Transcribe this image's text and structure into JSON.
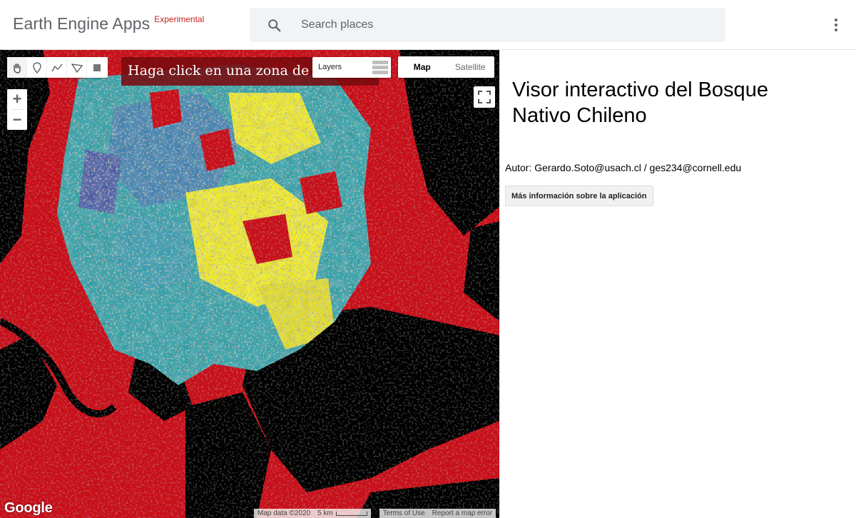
{
  "header": {
    "app_name": "Earth Engine Apps",
    "app_tag": "Experimental",
    "search_placeholder": "Search places",
    "search_icon": "search-icon",
    "menu_icon": "more-vertical-icon"
  },
  "map": {
    "draw_tools": [
      "hand-icon",
      "marker-icon",
      "line-icon",
      "polygon-icon",
      "rectangle-icon"
    ],
    "instruction": "Haga click en una zona de",
    "layers_label": "Layers",
    "map_types": {
      "map": "Map",
      "satellite": "Satellite",
      "selected": "Map"
    },
    "zoom_in": "+",
    "zoom_out": "−",
    "google_logo": "Google",
    "attribution": {
      "map_data": "Map data ©2020",
      "scale": "5 km",
      "terms": "Terms of Use",
      "report": "Report a map error"
    },
    "colors": {
      "nonforest": "#c8101a",
      "water": "#000000",
      "forest_high": "#f5ef1c",
      "forest_mid": "#29a0a8",
      "forest_low": "#4458a5"
    }
  },
  "panel": {
    "title": "Visor interactivo del Bosque Nativo Chileno",
    "author": "Autor: Gerardo.Soto@usach.cl / ges234@cornell.edu",
    "info_button": "Más información sobre la aplicación"
  }
}
